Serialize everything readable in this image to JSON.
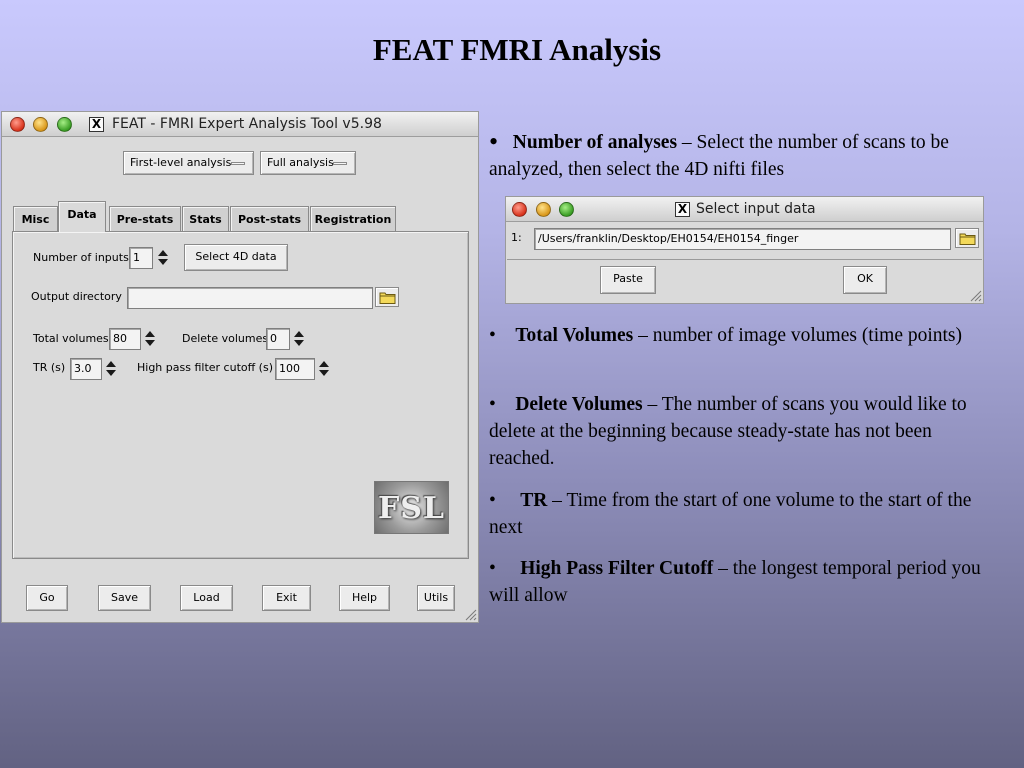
{
  "slide": {
    "title": "FEAT FMRI Analysis"
  },
  "feat_window": {
    "title": "FEAT - FMRI Expert Analysis Tool v5.98",
    "analysis_level": "First-level analysis",
    "analysis_type": "Full analysis",
    "tabs": [
      {
        "label": "Misc"
      },
      {
        "label": "Data"
      },
      {
        "label": "Pre-stats"
      },
      {
        "label": "Stats"
      },
      {
        "label": "Post-stats"
      },
      {
        "label": "Registration"
      }
    ],
    "active_tab": "Data",
    "data_tab": {
      "number_of_inputs_label": "Number of inputs",
      "number_of_inputs_value": "1",
      "select_4d_button": "Select 4D data",
      "output_directory_label": "Output directory",
      "output_directory_value": "",
      "total_volumes_label": "Total volumes",
      "total_volumes_value": "80",
      "delete_volumes_label": "Delete volumes",
      "delete_volumes_value": "0",
      "tr_label": "TR (s)",
      "tr_value": "3.0",
      "highpass_label": "High pass filter cutoff (s)",
      "highpass_value": "100",
      "logo_text": "FSL"
    },
    "bottom_buttons": {
      "go": "Go",
      "save": "Save",
      "load": "Load",
      "exit": "Exit",
      "help": "Help",
      "utils": "Utils"
    }
  },
  "select_window": {
    "title": "Select input data",
    "row_index": "1:",
    "row_path": "/Users/franklin/Desktop/EH0154/EH0154_finger",
    "paste_button": "Paste",
    "ok_button": "OK"
  },
  "bullets": [
    {
      "marker": "•",
      "term": "Number of analyses",
      "desc": " – Select the number of scans to be analyzed, then select the 4D nifti files"
    },
    {
      "marker": "•",
      "term": "Total Volumes",
      "desc": " – number of image volumes (time points)"
    },
    {
      "marker": "•",
      "term": "Delete Volumes",
      "desc": " – The number of scans you would like to delete at the beginning because steady-state has not been reached."
    },
    {
      "marker": "•",
      "term": "TR",
      "desc": " – Time from the start of one volume to the start of the next"
    },
    {
      "marker": "•",
      "term": "High Pass Filter Cutoff",
      "desc": " – the longest temporal period you will allow"
    }
  ],
  "icons": [
    "close-icon",
    "minimize-icon",
    "zoom-icon",
    "x11-icon",
    "folder-icon",
    "spin-up-icon",
    "spin-down-icon",
    "resize-grip-icon"
  ]
}
